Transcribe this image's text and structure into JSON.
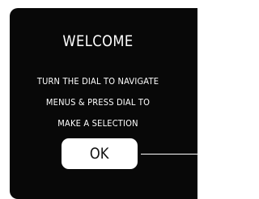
{
  "screen": {
    "title": "WELCOME",
    "message_lines": [
      "TURN THE DIAL TO NAVIGATE",
      "MENUS & PRESS DIAL TO",
      "MAKE A SELECTION"
    ],
    "ok_label": "OK"
  },
  "colors": {
    "background": "#080808",
    "text": "#ffffff",
    "button_bg": "#ffffff",
    "button_text": "#111111"
  }
}
